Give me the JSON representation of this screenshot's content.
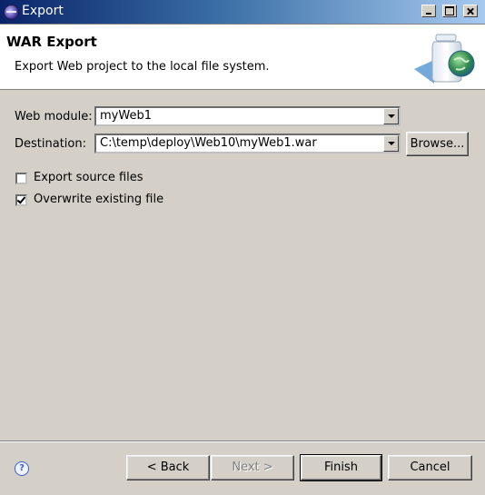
{
  "window": {
    "title": "Export",
    "icons": {
      "app": "eclipse-icon",
      "minimize": "minimize-icon",
      "maximize": "maximize-icon",
      "close": "close-icon"
    }
  },
  "banner": {
    "title": "WAR Export",
    "description": "Export Web project to the local file system.",
    "image_icon": "jar-globe-wizard-icon"
  },
  "form": {
    "web_module_label": "Web module:",
    "web_module_value": "myWeb1",
    "destination_label": "Destination:",
    "destination_value": "C:\\temp\\deploy\\Web10\\myWeb1.war",
    "browse_label": "Browse...",
    "export_source_label": "Export source files",
    "export_source_checked": false,
    "overwrite_label": "Overwrite existing file",
    "overwrite_checked": true
  },
  "footer": {
    "help_icon": "help-icon",
    "back_label": "< Back",
    "next_label": "Next >",
    "finish_label": "Finish",
    "cancel_label": "Cancel"
  }
}
